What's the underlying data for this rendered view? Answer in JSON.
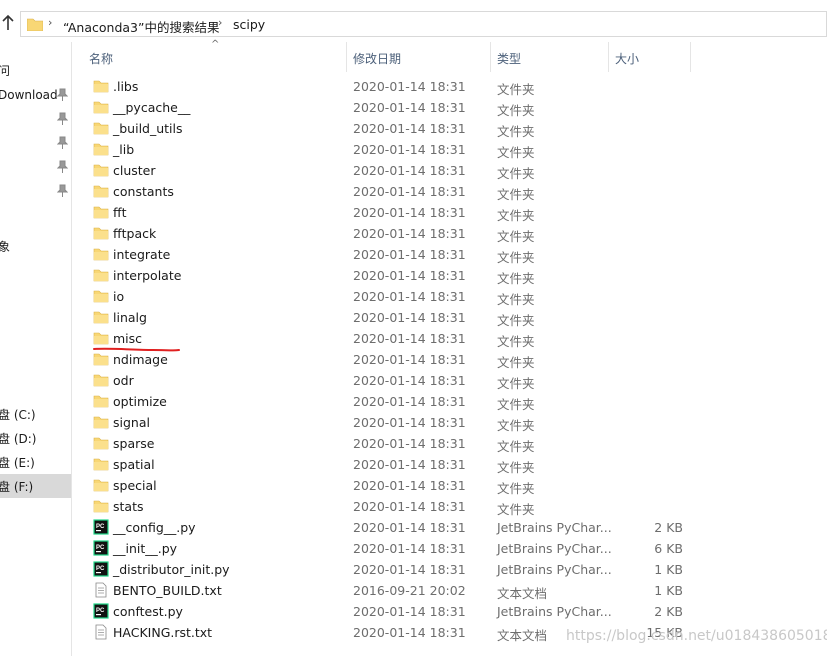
{
  "address_bar": {
    "segment_1": "“Anaconda3”中的搜索结果",
    "segment_2": "scipy"
  },
  "navigation_pane": {
    "items": [
      {
        "label": "问",
        "pinned": false
      },
      {
        "label": "Download",
        "pinned": true
      },
      {
        "label": "",
        "pinned": true
      },
      {
        "label": "",
        "pinned": true
      },
      {
        "label": "",
        "pinned": true
      },
      {
        "label": "",
        "pinned": true
      },
      {
        "label": "象",
        "pinned": false
      },
      {
        "label": "盘 (C:)",
        "pinned": false
      },
      {
        "label": "盘 (D:)",
        "pinned": false
      },
      {
        "label": "盘 (E:)",
        "pinned": false
      },
      {
        "label": "盘 (F:)",
        "pinned": false,
        "selected": true
      }
    ]
  },
  "columns": {
    "name": "名称",
    "date": "修改日期",
    "type": "类型",
    "size": "大小"
  },
  "files": [
    {
      "name": ".libs",
      "date": "2020-01-14 18:31",
      "type": "文件夹",
      "size": "",
      "icon": "folder-icon"
    },
    {
      "name": "__pycache__",
      "date": "2020-01-14 18:31",
      "type": "文件夹",
      "size": "",
      "icon": "folder-icon"
    },
    {
      "name": "_build_utils",
      "date": "2020-01-14 18:31",
      "type": "文件夹",
      "size": "",
      "icon": "folder-icon"
    },
    {
      "name": "_lib",
      "date": "2020-01-14 18:31",
      "type": "文件夹",
      "size": "",
      "icon": "folder-icon"
    },
    {
      "name": "cluster",
      "date": "2020-01-14 18:31",
      "type": "文件夹",
      "size": "",
      "icon": "folder-icon"
    },
    {
      "name": "constants",
      "date": "2020-01-14 18:31",
      "type": "文件夹",
      "size": "",
      "icon": "folder-icon"
    },
    {
      "name": "fft",
      "date": "2020-01-14 18:31",
      "type": "文件夹",
      "size": "",
      "icon": "folder-icon"
    },
    {
      "name": "fftpack",
      "date": "2020-01-14 18:31",
      "type": "文件夹",
      "size": "",
      "icon": "folder-icon"
    },
    {
      "name": "integrate",
      "date": "2020-01-14 18:31",
      "type": "文件夹",
      "size": "",
      "icon": "folder-icon"
    },
    {
      "name": "interpolate",
      "date": "2020-01-14 18:31",
      "type": "文件夹",
      "size": "",
      "icon": "folder-icon"
    },
    {
      "name": "io",
      "date": "2020-01-14 18:31",
      "type": "文件夹",
      "size": "",
      "icon": "folder-icon"
    },
    {
      "name": "linalg",
      "date": "2020-01-14 18:31",
      "type": "文件夹",
      "size": "",
      "icon": "folder-icon"
    },
    {
      "name": "misc",
      "date": "2020-01-14 18:31",
      "type": "文件夹",
      "size": "",
      "icon": "folder-icon"
    },
    {
      "name": "ndimage",
      "date": "2020-01-14 18:31",
      "type": "文件夹",
      "size": "",
      "icon": "folder-icon"
    },
    {
      "name": "odr",
      "date": "2020-01-14 18:31",
      "type": "文件夹",
      "size": "",
      "icon": "folder-icon"
    },
    {
      "name": "optimize",
      "date": "2020-01-14 18:31",
      "type": "文件夹",
      "size": "",
      "icon": "folder-icon"
    },
    {
      "name": "signal",
      "date": "2020-01-14 18:31",
      "type": "文件夹",
      "size": "",
      "icon": "folder-icon"
    },
    {
      "name": "sparse",
      "date": "2020-01-14 18:31",
      "type": "文件夹",
      "size": "",
      "icon": "folder-icon"
    },
    {
      "name": "spatial",
      "date": "2020-01-14 18:31",
      "type": "文件夹",
      "size": "",
      "icon": "folder-icon"
    },
    {
      "name": "special",
      "date": "2020-01-14 18:31",
      "type": "文件夹",
      "size": "",
      "icon": "folder-icon"
    },
    {
      "name": "stats",
      "date": "2020-01-14 18:31",
      "type": "文件夹",
      "size": "",
      "icon": "folder-icon"
    },
    {
      "name": "__config__.py",
      "date": "2020-01-14 18:31",
      "type": "JetBrains PyChar...",
      "size": "2 KB",
      "icon": "pycharm-file-icon"
    },
    {
      "name": "__init__.py",
      "date": "2020-01-14 18:31",
      "type": "JetBrains PyChar...",
      "size": "6 KB",
      "icon": "pycharm-file-icon"
    },
    {
      "name": "_distributor_init.py",
      "date": "2020-01-14 18:31",
      "type": "JetBrains PyChar...",
      "size": "1 KB",
      "icon": "pycharm-file-icon"
    },
    {
      "name": "BENTO_BUILD.txt",
      "date": "2016-09-21 20:02",
      "type": "文本文档",
      "size": "1 KB",
      "icon": "text-file-icon"
    },
    {
      "name": "conftest.py",
      "date": "2020-01-14 18:31",
      "type": "JetBrains PyChar...",
      "size": "2 KB",
      "icon": "pycharm-file-icon"
    },
    {
      "name": "HACKING.rst.txt",
      "date": "2020-01-14 18:31",
      "type": "文本文档",
      "size": "15 KB",
      "icon": "text-file-icon"
    }
  ],
  "watermark": "https://blog.csdn.net/u018438605018",
  "colors": {
    "folder": "#f8d775",
    "header_text": "#4c607a",
    "annotation_red": "#e02020"
  }
}
